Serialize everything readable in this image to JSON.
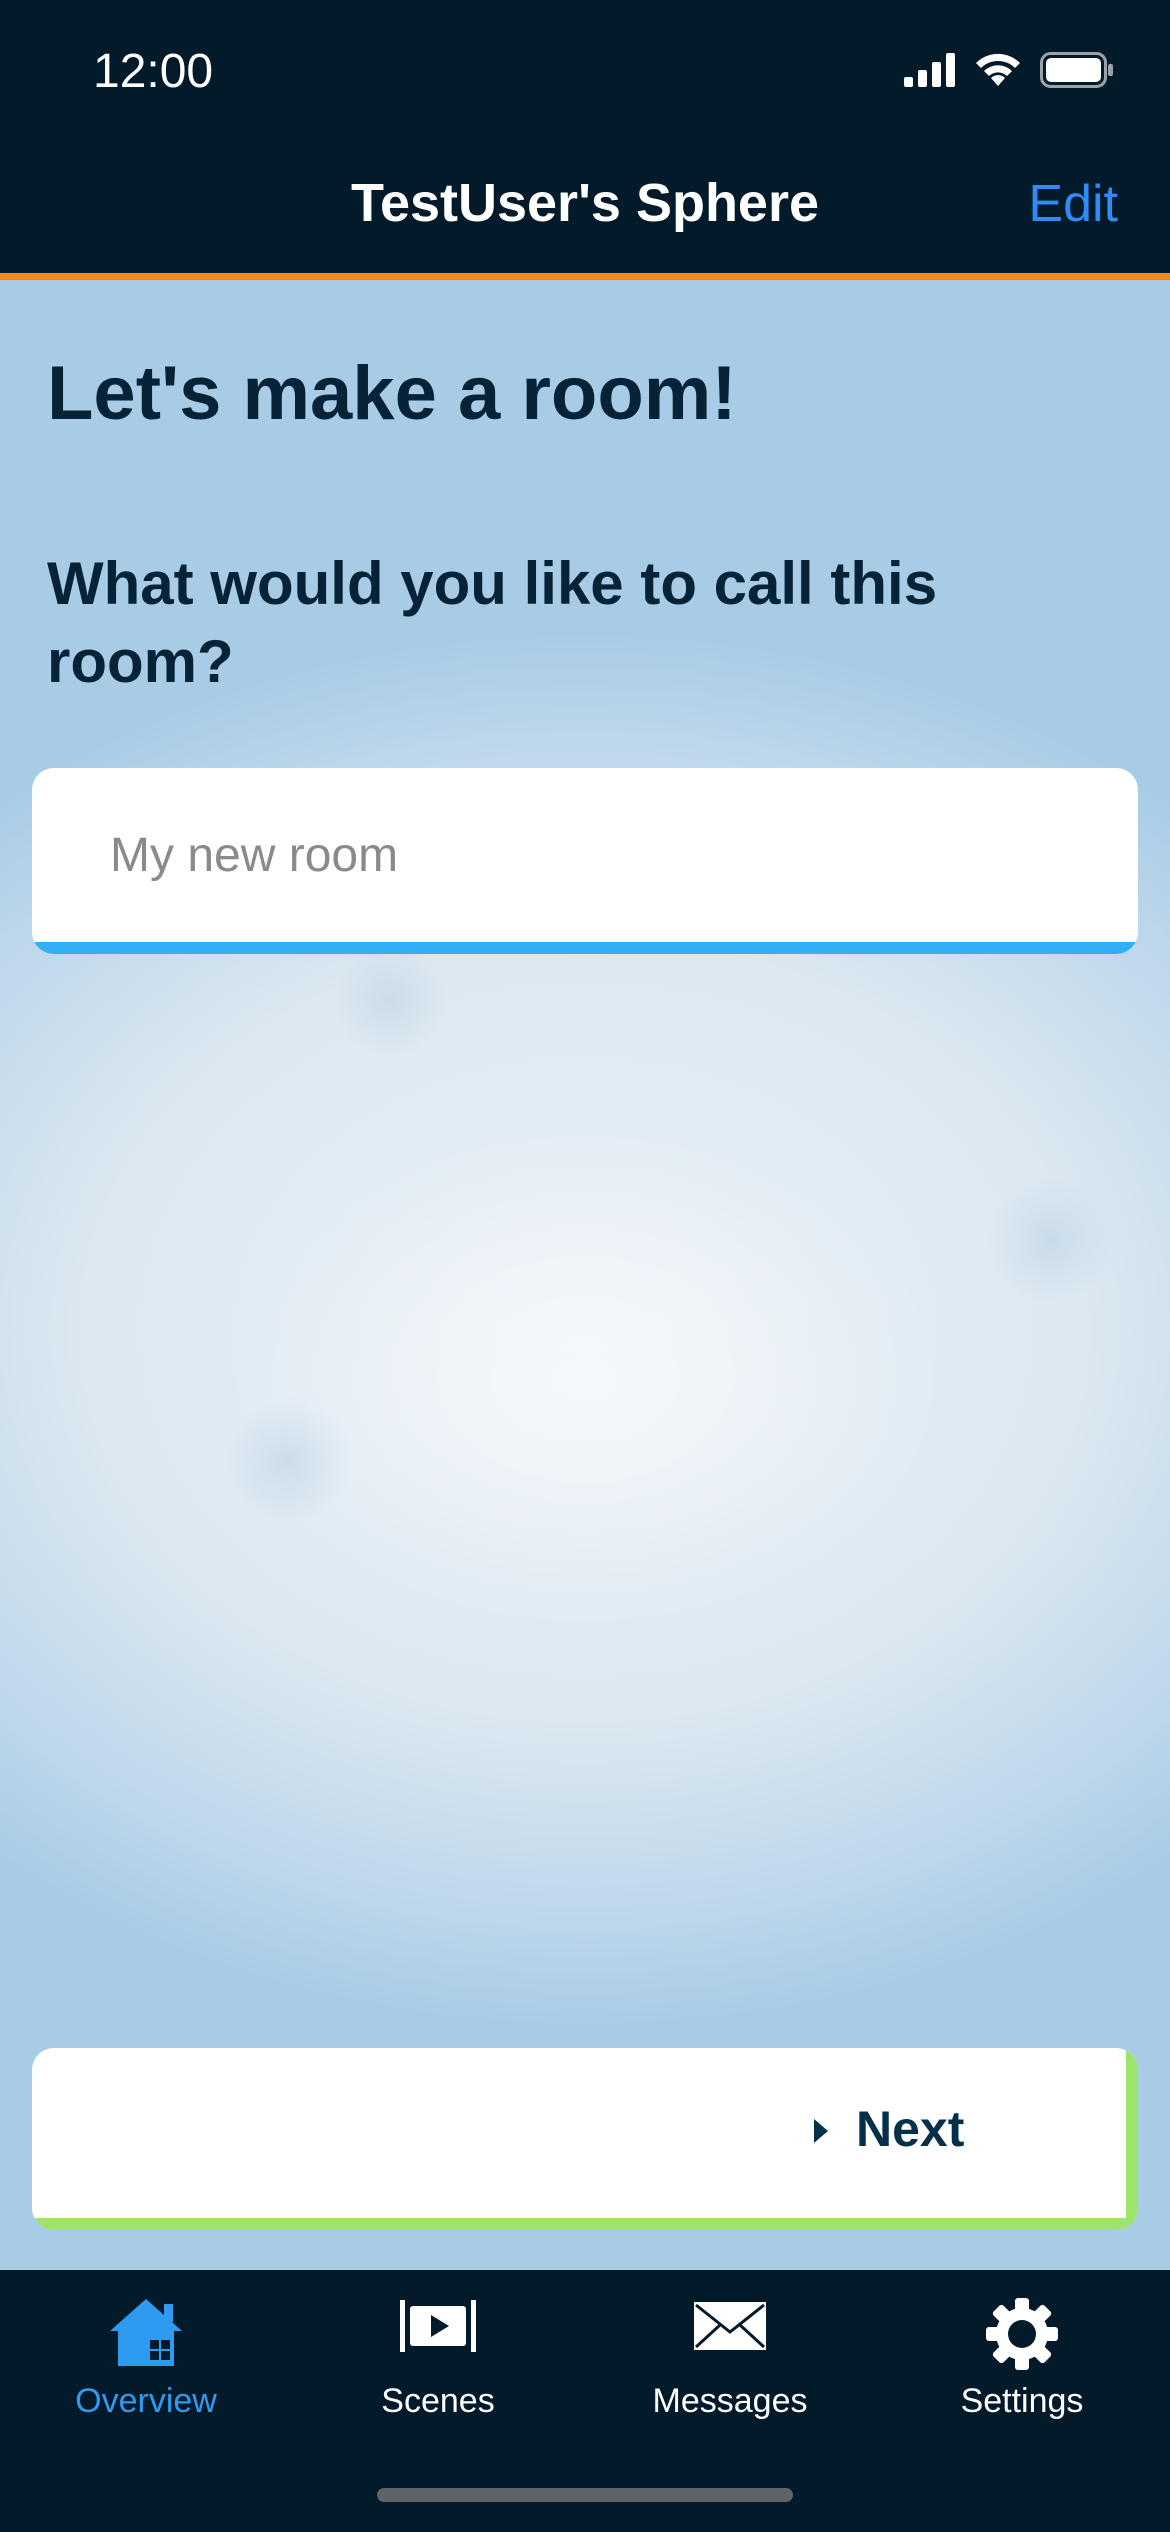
{
  "status_bar": {
    "time": "12:00",
    "icons": [
      "cellular-signal-icon",
      "wifi-icon",
      "battery-icon"
    ]
  },
  "nav_bar": {
    "title": "TestUser's Sphere",
    "edit_label": "Edit"
  },
  "main": {
    "headline": "Let's make a room!",
    "question": "What would you like to call this room?",
    "room_name_input": {
      "value": "",
      "placeholder": "My new room"
    },
    "next_button": {
      "icon": "caret-right-icon",
      "label": "Next"
    }
  },
  "tab_bar": {
    "tabs": [
      {
        "label": "Overview",
        "icon": "house-icon",
        "active": true
      },
      {
        "label": "Scenes",
        "icon": "scenes-icon",
        "active": false
      },
      {
        "label": "Messages",
        "icon": "envelope-icon",
        "active": false
      },
      {
        "label": "Settings",
        "icon": "gear-icon",
        "active": false
      }
    ]
  },
  "colors": {
    "header_bg": "#021a2a",
    "header_accent": "#f6871e",
    "link_blue": "#2f8cf5",
    "input_underline": "#34aef4",
    "next_accent": "#9ee36a",
    "active_tab": "#2f9bf0",
    "text_dark": "#062237"
  }
}
